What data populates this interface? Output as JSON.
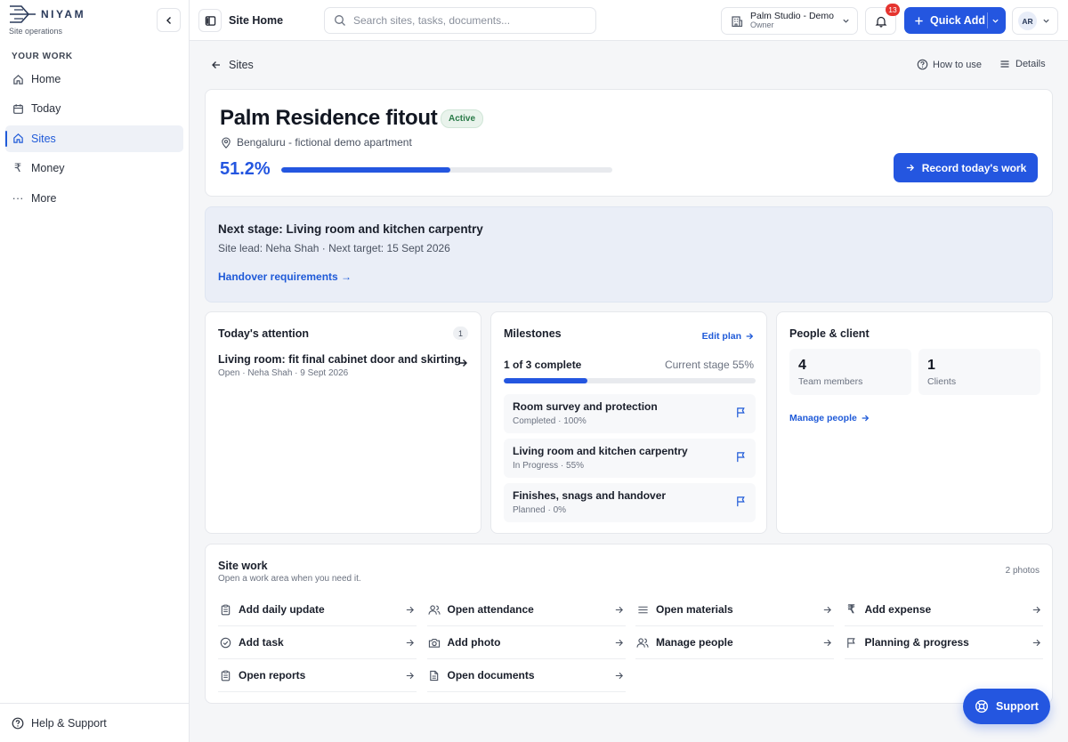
{
  "brand": {
    "name": "NIYAM",
    "subtitle": "Site operations"
  },
  "sidebar": {
    "heading": "YOUR WORK",
    "items": [
      {
        "label": "Home",
        "icon": "home-icon"
      },
      {
        "label": "Today",
        "icon": "calendar-icon"
      },
      {
        "label": "Sites",
        "icon": "home-icon",
        "active": true
      },
      {
        "label": "Money",
        "icon": "rupee-icon"
      },
      {
        "label": "More",
        "icon": "more-icon"
      }
    ],
    "footer": "Help & Support"
  },
  "topbar": {
    "title": "Site Home",
    "search_placeholder": "Search sites, tasks, documents...",
    "org_name": "Palm Studio - Demo",
    "org_role": "Owner",
    "notifications": "13",
    "quick_add": "Quick Add",
    "avatar": "AR"
  },
  "nav": {
    "back": "Sites",
    "how_to_use": "How to use",
    "details": "Details"
  },
  "site": {
    "title": "Palm Residence fitout",
    "status": "Active",
    "location": "Bengaluru - fictional demo apartment",
    "progress_label": "51.2%",
    "progress": 0.512,
    "record_button": "Record today's work"
  },
  "stage": {
    "title": "Next stage: Living room and kitchen carpentry",
    "subtitle": "Site lead: Neha Shah · Next target: 15 Sept 2026",
    "link": "Handover requirements →"
  },
  "attention": {
    "title": "Today's attention",
    "count": "1",
    "item_title": "Living room: fit final cabinet door and skirting",
    "item_meta": "Open · Neha Shah · 9 Sept 2026"
  },
  "milestones": {
    "title": "Milestones",
    "edit_link": "Edit plan",
    "count_text": "1 of 3 complete",
    "stage_text": "Current stage 55%",
    "progress": 0.333,
    "items": [
      {
        "title": "Room survey and protection",
        "meta": "Completed · 100%"
      },
      {
        "title": "Living room and kitchen carpentry",
        "meta": "In Progress · 55%"
      },
      {
        "title": "Finishes, snags and handover",
        "meta": "Planned · 0%"
      }
    ]
  },
  "people": {
    "title": "People & client",
    "team_count": "4",
    "team_label": "Team members",
    "client_count": "1",
    "client_label": "Clients",
    "manage_link": "Manage people"
  },
  "sitework": {
    "title": "Site work",
    "subtitle": "Open a work area when you need it.",
    "photos": "2 photos",
    "items": [
      {
        "label": "Add daily update",
        "icon": "clipboard-icon"
      },
      {
        "label": "Open attendance",
        "icon": "users-icon"
      },
      {
        "label": "Open materials",
        "icon": "list-icon"
      },
      {
        "label": "Add expense",
        "icon": "rupee-icon"
      },
      {
        "label": "Add task",
        "icon": "check-circle-icon"
      },
      {
        "label": "Add photo",
        "icon": "camera-icon"
      },
      {
        "label": "Manage people",
        "icon": "users-icon"
      },
      {
        "label": "Planning & progress",
        "icon": "flag-icon"
      },
      {
        "label": "Open reports",
        "icon": "clipboard-icon"
      },
      {
        "label": "Open documents",
        "icon": "document-icon"
      }
    ]
  },
  "support_label": "Support",
  "colors": {
    "accent": "#2456e0",
    "badge": "#e5342f",
    "active_status": "#2a7a48"
  }
}
